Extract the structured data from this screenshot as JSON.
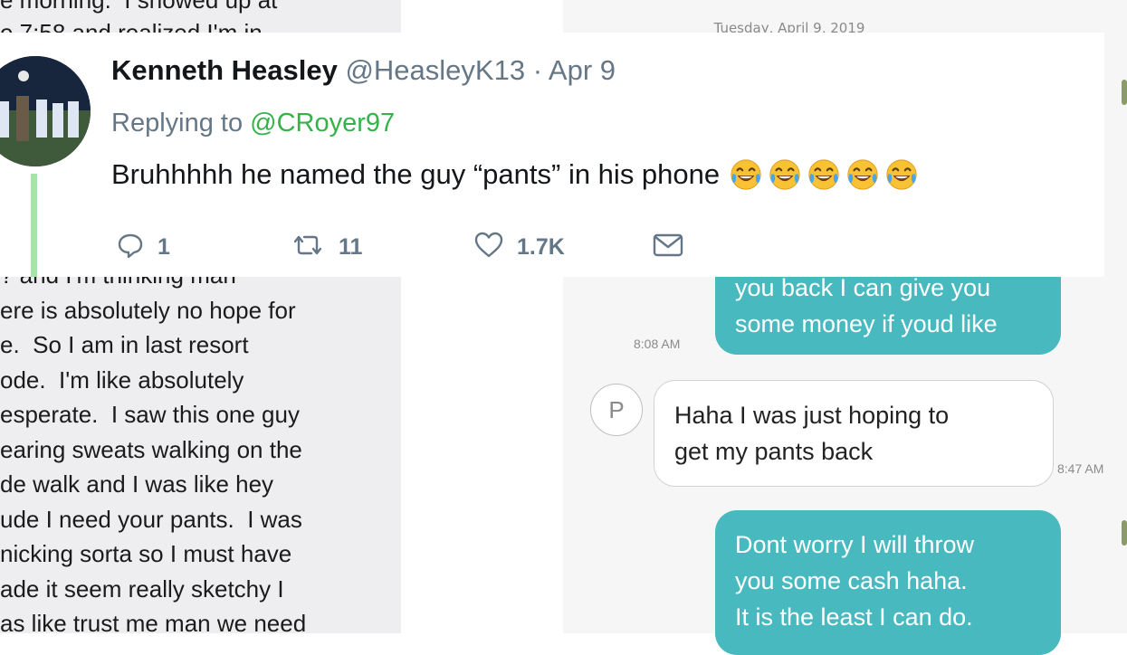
{
  "note": {
    "top_lines": [
      "e morning.  I showed up at",
      "e 7:58 and realized I'm in"
    ],
    "body_lines": [
      "? and I'm thinking man",
      "ere is absolutely no hope for",
      "e.  So I am in last resort",
      "ode.  I'm like absolutely",
      "esperate.  I saw this one guy",
      "earing sweats walking on the",
      "de walk and I was like hey",
      "ude I need your pants.  I was",
      "nicking sorta so I must have",
      "ade it seem really sketchy I",
      "as like trust me man we need"
    ]
  },
  "messages": {
    "date_header": "Tuesday, April 9, 2019",
    "bubble_outgoing_1": "you back I can give you\nsome money if youd like",
    "time_1": "8:08 AM",
    "contact_initial": "P",
    "bubble_incoming": "Haha I was just hoping to\nget my pants back",
    "time_2": "8:47 AM",
    "bubble_outgoing_2": "Dont worry I will throw\nyou some cash haha.\nIt is the least I can do."
  },
  "tweet": {
    "display_name": "Kenneth Heasley",
    "handle": "@HeasleyK13",
    "separator": " · ",
    "date": "Apr 9",
    "replying_prefix": "Replying to ",
    "replying_to": "@CRoyer97",
    "text": "Bruhhhhh he named the guy “pants” in his phone",
    "emoji_name": "face-with-tears-of-joy",
    "emoji_count": 5,
    "reply_count": "1",
    "retweet_count": "11",
    "like_count": "1.7K",
    "colors": {
      "reply_link": "#35b24a",
      "thread_line": "#a6e4a7",
      "bubble": "#49b9c0"
    }
  }
}
